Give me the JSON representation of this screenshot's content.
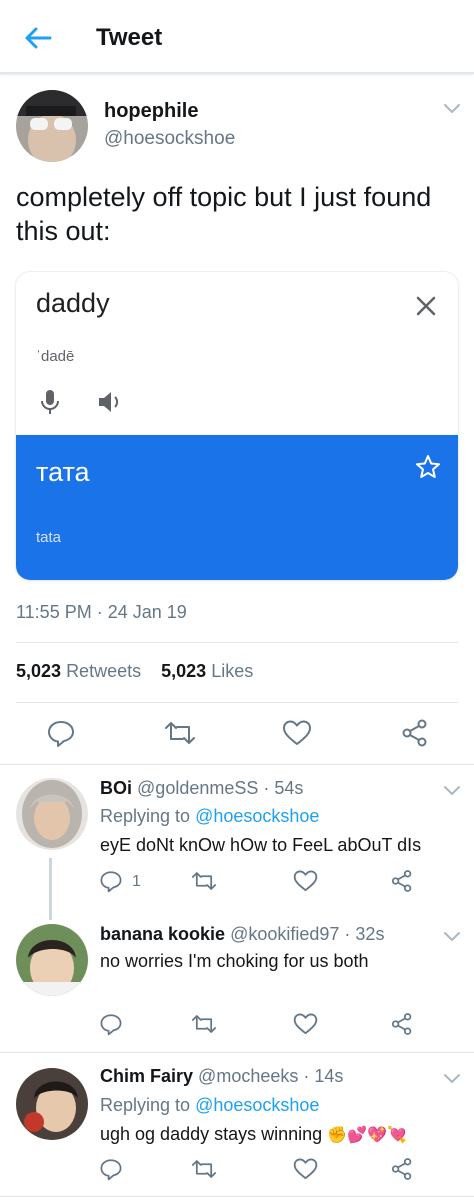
{
  "header": {
    "title": "Tweet"
  },
  "main_tweet": {
    "name": "hopephile",
    "handle": "@hoesockshoe",
    "text": "completely off topic but I just found this out:",
    "card": {
      "word": "daddy",
      "phonetic": "ˈdadē",
      "translation": "тата",
      "transliteration": "tata"
    },
    "timestamp": "11:55 PM · 24 Jan 19",
    "retweets_count": "5,023",
    "retweets_label": "Retweets",
    "likes_count": "5,023",
    "likes_label": "Likes"
  },
  "replies": [
    {
      "name": "BOi",
      "handle": "@goldenmeSS",
      "time": "· 54s",
      "replying_prefix": "Replying to",
      "replying_to": "@hoesockshoe",
      "text": "eyE doNt knOw hOw to FeeL abOuT dIs",
      "reply_count": "1"
    },
    {
      "name": "banana kookie",
      "handle": "@kookified97",
      "time": "· 32s",
      "text": "no worries I'm choking for us both"
    },
    {
      "name": "Chim Fairy",
      "handle": "@mocheeks",
      "time": "· 14s",
      "replying_prefix": "Replying to",
      "replying_to": "@hoesockshoe",
      "text": "ugh og daddy stays winning",
      "emoji": "✊💕💖💘"
    }
  ],
  "colors": {
    "accent": "#1da1f2",
    "translate_blue": "#1a73e8",
    "muted": "#657786"
  }
}
